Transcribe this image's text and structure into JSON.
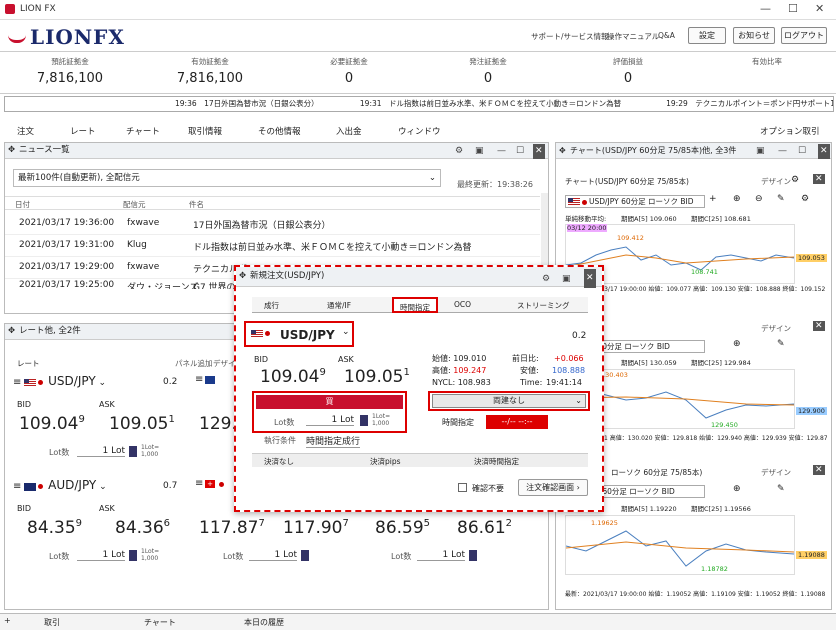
{
  "window": {
    "title": "LION FX",
    "min": "—",
    "max": "☐",
    "close": "✕"
  },
  "brand": {
    "logo": "LIONFX"
  },
  "header_links": [
    "サポート/サービス情報",
    "操作マニュアル",
    "Q&A"
  ],
  "header_buttons": [
    "設定",
    "お知らせ",
    "ログアウト"
  ],
  "summary": [
    {
      "label": "預託証拠金",
      "value": "7,816,100"
    },
    {
      "label": "有効証拠金",
      "value": "7,816,100"
    },
    {
      "label": "必要証拠金",
      "value": "0"
    },
    {
      "label": "発注証拠金",
      "value": "0"
    },
    {
      "label": "評価損益",
      "value": "0"
    },
    {
      "label": "有効比率",
      "value": ""
    }
  ],
  "ticker": "19:36　17日外国為替市況（日銀公表分）　　　　　　19:31　ドル指数は前日並み水準、米ＦＯＭＣを控えて小動き＝ロンドン為替　　　　　　19:29　テクニカルポイント＝ポンド円サポート1　150.80（一目",
  "menu": [
    "注文",
    "レート",
    "チャート",
    "取引情報",
    "その他情報",
    "入出金",
    "ウィンドウ",
    "オプション取引"
  ],
  "news": {
    "title": "ニュース一覧",
    "filter": "最新100件(自動更新), 全配信元",
    "updated": "最終更新：19:38:26",
    "columns": [
      "日付",
      "配信元",
      "件名"
    ],
    "rows": [
      {
        "date": "2021/03/17 19:36:00",
        "src": "fxwave",
        "subject": "17日外国為替市況（日銀公表分）"
      },
      {
        "date": "2021/03/17 19:31:00",
        "src": "Klug",
        "subject": "ドル指数は前日並み水準、米ＦＯＭＣを控えて小動き＝ロンドン為替"
      },
      {
        "date": "2021/03/17 19:29:00",
        "src": "fxwave",
        "subject": "テクニカルポ"
      },
      {
        "date": "2021/03/17 19:25:00",
        "src": "ダウ・ジョーンズ",
        "subject": "G7 世界の"
      }
    ]
  },
  "rates": {
    "title": "レート他, 全2件",
    "col_label": "レート",
    "col_panel": "パネル追加",
    "col_design": "デザイン",
    "cards": [
      {
        "pair": "USD/JPY",
        "spread": "0.2",
        "bid_label": "BID",
        "ask_label": "ASK",
        "bid_main": "109.04",
        "bid_sup": "9",
        "ask_main": "109.05",
        "ask_sup": "1",
        "lot_label": "Lot数",
        "lot": "1",
        "lot_unit": "Lot",
        "lot_note": "1Lot= 1,000"
      },
      {
        "pair": "EUR/JPY",
        "bid_main": "129.9"
      },
      {
        "pair": "AUD/JPY",
        "spread": "0.7",
        "bid_label": "BID",
        "ask_label": "ASK",
        "bid_main": "84.35",
        "bid_sup": "9",
        "ask_main": "84.36",
        "ask_sup": "6",
        "lot_label": "Lot数",
        "lot": "1",
        "lot_unit": "Lot",
        "lot_note": "1Lot= 1,000"
      },
      {
        "pair": "CHF/JPY",
        "bid_main": "117.87",
        "bid_sup": "7",
        "ask_main": "117.90",
        "ask_sup": "7",
        "lot_label": "Lot数",
        "lot": "1",
        "lot_unit": "Lot"
      },
      {
        "bid_main": "86.59",
        "bid_sup": "5",
        "ask_main": "86.61",
        "ask_sup": "2",
        "lot_label": "Lot数",
        "lot": "1",
        "lot_unit": "Lot"
      }
    ]
  },
  "charts": {
    "title": "チャート(USD/JPY 60分足 75/85本)他, 全3件",
    "design": "デザイン",
    "items": [
      {
        "title": "チャート(USD/JPY 60分足 75/85本)",
        "pair": "USD/JPY 60分足 ローソク BID",
        "legend1": "単純移動平均:",
        "legend2": "期間A[5] 109.060",
        "legend3": "期間C[25] 108.681",
        "date1": "03/12 20:00",
        "date2": "16",
        "date3": "03/17",
        "date4": "16",
        "hi": "109.412",
        "lo": "108.741",
        "price": "109.053",
        "footer": "最新：2021/03/17 19:00:00 始値：109.077 高値：109.130 安値：108.888 終値：109.152 安値：108.888 終値：109.053"
      },
      {
        "pair": "EUR/JPY 60分足 ローソク BID",
        "legend2": "期間A[5] 130.059",
        "legend3": "期間C[25] 129.984",
        "hi": "130.403",
        "lo": "129.450",
        "price": "129.900",
        "footer": "始値：129.971 高値：130.020 安値：129.818 始値：129.940 高値：129.939 安値：129.875"
      },
      {
        "title": "ローソク 60分足 75/85本)",
        "pair": "EUR/USD 60分足 ローソク BID",
        "legend2": "期間A[5] 1.19220",
        "legend3": "期間C[25] 1.19566",
        "hi": "1.19625",
        "lo": "1.18782",
        "price": "1.19088",
        "footer": "最新：2021/03/17 19:00:00 始値：1.19052 高値：1.19109 安値：1.19052 終値：1.19088"
      }
    ]
  },
  "dialog": {
    "title": "新規注文(USD/JPY)",
    "tabs": [
      "成行",
      "通常/IF",
      "時間指定",
      "OCO",
      "ストリーミング"
    ],
    "pair": "USD/JPY",
    "spread": "0.2",
    "bid_label": "BID",
    "ask_label": "ASK",
    "bid_main": "109.04",
    "bid_sup": "9",
    "ask_main": "109.05",
    "ask_sup": "1",
    "stats": {
      "open_l": "始値:",
      "open": "109.010",
      "prev_l": "前日比:",
      "prev": "+0.066",
      "high_l": "高値:",
      "high": "109.247",
      "low_l": "安値:",
      "low": "108.888",
      "nycl_l": "NYCL:",
      "nycl": "108.983",
      "time_l": "Time:",
      "time": "19:41:14"
    },
    "buy_label": "買",
    "sell_dropdown": "両建なし",
    "lot_label": "Lot数",
    "lot": "1",
    "lot_unit": "Lot",
    "lot_note": "1Lot= 1,000",
    "time_label": "時間指定",
    "time_value": "--/-- --:--",
    "cond_label": "執行条件",
    "cond_value": "時間指定成行",
    "settle_cols": [
      "決済なし",
      "決済pips",
      "決済時間指定"
    ],
    "confirm_label": "確認不要",
    "confirm_btn": "注文確認画面"
  },
  "statusbar": [
    "取引",
    "チャート",
    "本日の履歴"
  ]
}
